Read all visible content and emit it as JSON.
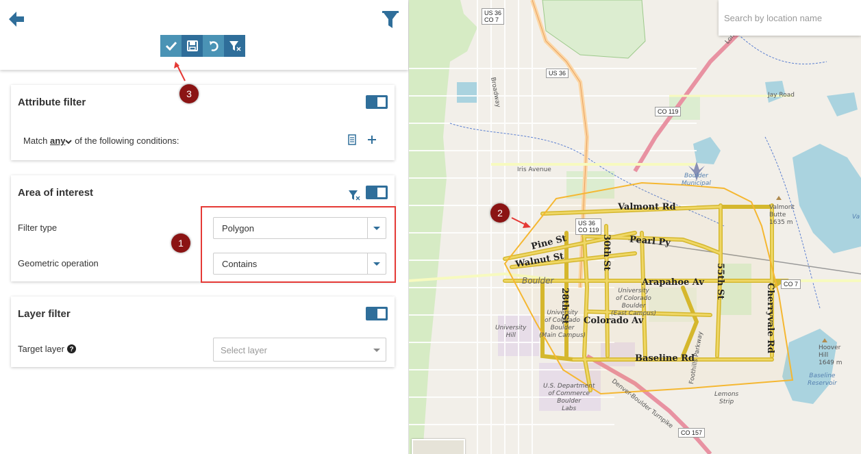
{
  "toolbar": {
    "apply_tooltip": "apply-filter",
    "save_tooltip": "save",
    "undo_tooltip": "undo",
    "clear_tooltip": "clear-filter"
  },
  "attribute_filter": {
    "title": "Attribute filter",
    "match_prefix": "Match",
    "match_value": "any",
    "match_suffix": "of the following conditions:"
  },
  "area_of_interest": {
    "title": "Area of interest",
    "filter_type_label": "Filter type",
    "filter_type_value": "Polygon",
    "geometric_operation_label": "Geometric operation",
    "geometric_operation_value": "Contains"
  },
  "layer_filter": {
    "title": "Layer filter",
    "target_layer_label": "Target layer",
    "target_layer_placeholder": "Select layer"
  },
  "markers": {
    "m1": "1",
    "m2": "2",
    "m3": "3"
  },
  "map": {
    "search_placeholder": "Search by location name",
    "roads": {
      "valmont": "Valmont Rd",
      "pine": "Pine St",
      "walnut": "Walnut St",
      "pearl": "Pearl Py",
      "arapahoe": "Arapahoe Av",
      "colorado": "Colorado Av",
      "baseline": "Baseline Rd",
      "st28": "28th St",
      "st30": "30th St",
      "st55": "55th St",
      "cherryvale": "Cherryvale Rd",
      "iris": "Iris Avenue",
      "jay": "Jay Road",
      "broadway": "Broadway",
      "foothills": "Foothills Parkway",
      "turnpike": "Denver-Boulder Turnpike",
      "longmont": "Longmont"
    },
    "shields": {
      "us36_co7": "US 36\nCO 7",
      "us36_a": "US 36",
      "co119_a": "CO 119",
      "us36_co119": "US 36\nCO 119",
      "co7": "CO 7",
      "co157": "CO 157"
    },
    "places": {
      "airport": "Boulder\nMunicipal",
      "valmont_butte": "Valmont\nButte\n1635 m",
      "hoover_hill": "Hoover\nHill\n1649 m",
      "cu_east": "University\nof Colorado\nBoulder\n(East Campus)",
      "cu_main": "University\nof Colorado\nBoulder\n(Main Campus)",
      "university_hill": "University\nHill",
      "commerce": "U.S. Department\nof Commerce\nBoulder\nLabs",
      "boulder": "Boulder",
      "lemons": "Lemons\nStrip",
      "baseline_res": "Baseline\nReservoir",
      "valmont_res_partial": "Va"
    }
  },
  "colors": {
    "primary": "#2f6e9a",
    "toolbar_light": "#4a93b5",
    "marker": "#8b1414",
    "highlight": "#e53935",
    "polygon": "#f5b731"
  }
}
